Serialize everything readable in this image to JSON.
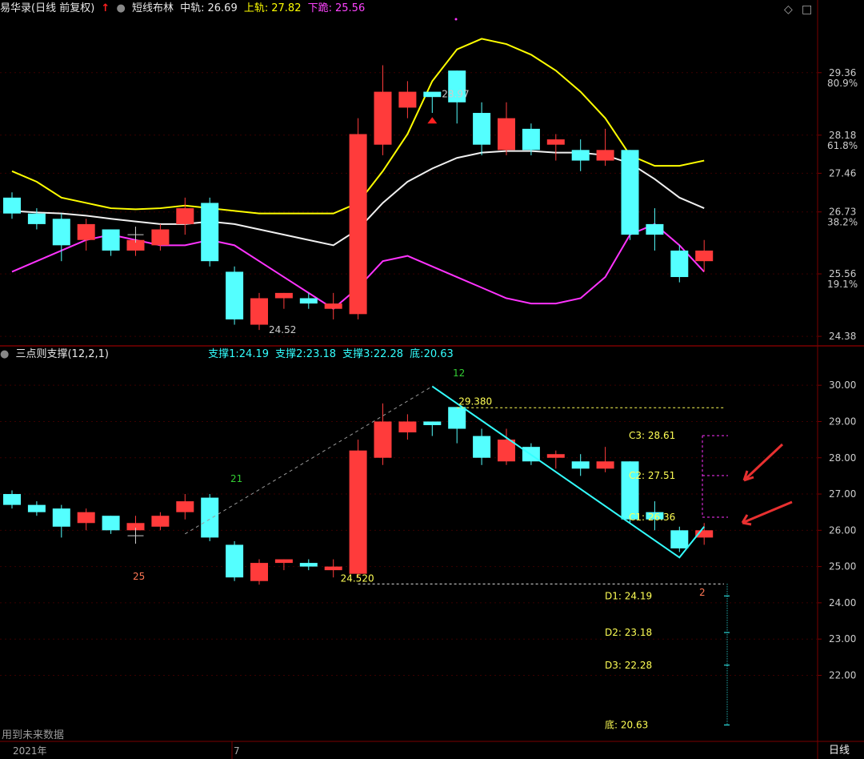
{
  "colors": {
    "up": "#ff3b3b",
    "down": "#54ffff",
    "mid": "#f0f0f0",
    "upper": "#ffff00",
    "lower": "#ff33ff",
    "grid": "#7a0000",
    "text": "#cccccc",
    "yellowtext": "#ffff55",
    "cyan": "#33ffff"
  },
  "panel1": {
    "title": "易华录(日线 前复权)",
    "indicator": "短线布林",
    "mid_label": "中轨:",
    "mid_value": "26.69",
    "upper_label": "上轨:",
    "upper_value": "27.82",
    "lower_label": "下跪:",
    "lower_value": "25.56",
    "price_labels": [
      "29.36",
      "28.18",
      "27.46",
      "26.73",
      "25.56",
      "24.38"
    ],
    "pct_labels": [
      "80.9%",
      "61.8%",
      "38.2%",
      "19.1%"
    ],
    "high_label": "28.97",
    "low_label": "24.52"
  },
  "panel2": {
    "title": "三点则支撑(12,2,1)",
    "s1_label": "支撑1:",
    "s1": "24.19",
    "s2_label": "支撑2:",
    "s2": "23.18",
    "s3_label": "支撑3:",
    "s3": "22.28",
    "bottom_label": "底:",
    "bottom": "20.63",
    "price_labels": [
      "30.00",
      "29.00",
      "28.00",
      "27.00",
      "26.00",
      "25.00",
      "24.00",
      "23.00",
      "22.00"
    ],
    "peak_label": "29.380",
    "trough_label": "24.520",
    "count_labels": [
      "12",
      "21",
      "25",
      "2"
    ],
    "c_labels": [
      "C3: 28.61",
      "C2: 27.51",
      "C1: 26.36"
    ],
    "d_labels": [
      "D1: 24.19",
      "D2: 23.18",
      "D3: 22.28",
      "底: 20.63"
    ],
    "footer_note": "用到未来数据"
  },
  "xaxis": {
    "year": "2021年",
    "month": "7",
    "period": "日线"
  },
  "chart_data": {
    "type": "candlestick",
    "candles": [
      {
        "o": 27.0,
        "c": 26.7,
        "h": 27.1,
        "l": 26.6
      },
      {
        "o": 26.7,
        "c": 26.5,
        "h": 26.8,
        "l": 26.4
      },
      {
        "o": 26.6,
        "c": 26.1,
        "h": 26.7,
        "l": 25.8
      },
      {
        "o": 26.2,
        "c": 26.5,
        "h": 26.6,
        "l": 26.0
      },
      {
        "o": 26.4,
        "c": 26.0,
        "h": 26.4,
        "l": 25.9
      },
      {
        "o": 26.0,
        "c": 26.2,
        "h": 26.4,
        "l": 25.9
      },
      {
        "o": 26.1,
        "c": 26.4,
        "h": 26.5,
        "l": 26.0
      },
      {
        "o": 26.5,
        "c": 26.8,
        "h": 27.0,
        "l": 26.3
      },
      {
        "o": 26.9,
        "c": 25.8,
        "h": 27.0,
        "l": 25.7
      },
      {
        "o": 25.6,
        "c": 24.7,
        "h": 25.7,
        "l": 24.6
      },
      {
        "o": 24.6,
        "c": 25.1,
        "h": 25.2,
        "l": 24.5
      },
      {
        "o": 25.1,
        "c": 25.2,
        "h": 25.2,
        "l": 24.9
      },
      {
        "o": 25.1,
        "c": 25.0,
        "h": 25.2,
        "l": 24.9
      },
      {
        "o": 24.9,
        "c": 25.0,
        "h": 25.2,
        "l": 24.7
      },
      {
        "o": 24.8,
        "c": 28.2,
        "h": 28.5,
        "l": 24.7
      },
      {
        "o": 28.0,
        "c": 29.0,
        "h": 29.5,
        "l": 27.8
      },
      {
        "o": 28.7,
        "c": 29.0,
        "h": 29.2,
        "l": 28.5
      },
      {
        "o": 29.0,
        "c": 28.9,
        "h": 28.97,
        "l": 28.6
      },
      {
        "o": 29.4,
        "c": 28.8,
        "h": 29.4,
        "l": 28.4
      },
      {
        "o": 28.6,
        "c": 28.0,
        "h": 28.8,
        "l": 27.8
      },
      {
        "o": 27.9,
        "c": 28.5,
        "h": 28.8,
        "l": 27.8
      },
      {
        "o": 28.3,
        "c": 27.9,
        "h": 28.4,
        "l": 27.8
      },
      {
        "o": 28.0,
        "c": 28.1,
        "h": 28.2,
        "l": 27.7
      },
      {
        "o": 27.9,
        "c": 27.7,
        "h": 28.1,
        "l": 27.5
      },
      {
        "o": 27.7,
        "c": 27.9,
        "h": 28.3,
        "l": 27.6
      },
      {
        "o": 27.9,
        "c": 26.3,
        "h": 27.9,
        "l": 26.2
      },
      {
        "o": 26.5,
        "c": 26.3,
        "h": 26.8,
        "l": 26.0
      },
      {
        "o": 26.0,
        "c": 25.5,
        "h": 26.1,
        "l": 25.4
      },
      {
        "o": 25.8,
        "c": 26.0,
        "h": 26.2,
        "l": 25.6
      }
    ],
    "mid": [
      26.75,
      26.72,
      26.7,
      26.66,
      26.6,
      26.55,
      26.5,
      26.5,
      26.55,
      26.5,
      26.4,
      26.3,
      26.2,
      26.1,
      26.4,
      26.9,
      27.3,
      27.55,
      27.75,
      27.85,
      27.88,
      27.88,
      27.85,
      27.85,
      27.8,
      27.65,
      27.35,
      27.0,
      26.8
    ],
    "upper": [
      27.5,
      27.3,
      27.0,
      26.9,
      26.8,
      26.78,
      26.8,
      26.85,
      26.8,
      26.75,
      26.7,
      26.7,
      26.7,
      26.7,
      26.9,
      27.5,
      28.2,
      29.2,
      29.8,
      30.0,
      29.9,
      29.7,
      29.4,
      29.0,
      28.5,
      27.8,
      27.6,
      27.6,
      27.7
    ],
    "lower": [
      25.6,
      25.8,
      26.0,
      26.2,
      26.3,
      26.2,
      26.1,
      26.1,
      26.2,
      26.1,
      25.8,
      25.5,
      25.2,
      24.9,
      25.3,
      25.8,
      25.9,
      25.7,
      25.5,
      25.3,
      25.1,
      25.0,
      25.0,
      25.1,
      25.5,
      26.3,
      26.5,
      26.1,
      25.6
    ],
    "panel2_candles_note": "same OHLC series",
    "zigzag": [
      [
        7,
        25.9
      ],
      [
        17,
        29.97
      ],
      [
        27,
        25.25
      ],
      [
        28,
        26.1
      ]
    ],
    "peak": 29.38,
    "trough": 24.52,
    "c_levels": [
      28.61,
      27.51,
      26.36
    ],
    "d_levels": [
      24.19,
      23.18,
      22.28,
      20.63
    ]
  }
}
